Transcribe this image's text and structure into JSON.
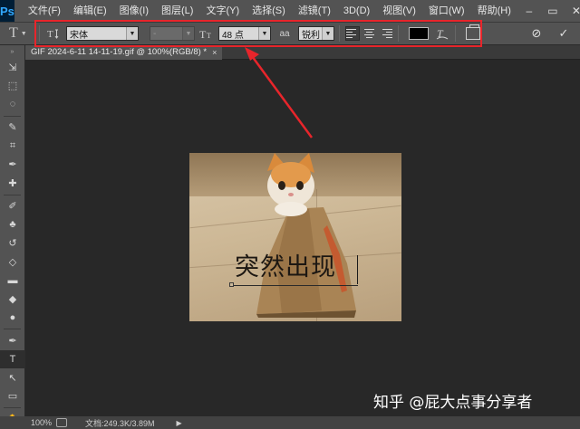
{
  "app": {
    "logo": "Ps"
  },
  "menu": [
    "文件(F)",
    "编辑(E)",
    "图像(I)",
    "图层(L)",
    "文字(Y)",
    "选择(S)",
    "滤镜(T)",
    "3D(D)",
    "视图(V)",
    "窗口(W)",
    "帮助(H)"
  ],
  "window_controls": [
    "–",
    "▭",
    "✕"
  ],
  "options": {
    "tool_preset_icon": "T",
    "orientation_icon": "text-orientation-icon",
    "font_family": "宋体",
    "font_style": "-",
    "size_icon": "font-size-icon",
    "font_size": "48 点",
    "aa_icon_text": "aa",
    "anti_alias": "锐利",
    "alignment": [
      "left",
      "center",
      "right"
    ],
    "active_alignment": "left",
    "text_color": "#000000",
    "warp_icon": "warp-text-icon",
    "panels_icon": "character-panel-icon",
    "cancel_symbol": "⊘",
    "commit_symbol": "✓"
  },
  "document": {
    "tab_title": "GIF 2024-6-11 14-11-19.gif @ 100%(RGB/8) *",
    "tab_close": "×",
    "layer_text": "突然出现"
  },
  "tools": [
    "move-tool-icon",
    "marquee-tool-icon",
    "lasso-tool-icon",
    "quick-selection-tool-icon",
    "crop-tool-icon",
    "eyedropper-tool-icon",
    "healing-brush-tool-icon",
    "brush-tool-icon",
    "clone-stamp-tool-icon",
    "history-brush-tool-icon",
    "eraser-tool-icon",
    "gradient-tool-icon",
    "blur-tool-icon",
    "dodge-tool-icon",
    "pen-tool-icon",
    "type-tool-icon",
    "path-selection-tool-icon",
    "rectangle-tool-icon",
    "hand-tool-icon",
    "zoom-tool-icon"
  ],
  "tool_glyphs": [
    "⇲",
    "⬚",
    "◌",
    "✎",
    "⌗",
    "✒",
    "✚",
    "✐",
    "♣",
    "↺",
    "◇",
    "▬",
    "◆",
    "●",
    "✒",
    "T",
    "↖",
    "▭",
    "✋",
    "⚲"
  ],
  "active_tool": "type-tool-icon",
  "status": {
    "zoom": "100%",
    "doc_size": "文档:249.3K/3.89M",
    "arrow": "▶"
  },
  "watermark": "知乎 @屁大点事分享者",
  "colors": {
    "highlight": "#e8252b",
    "accent": "#31a8ff"
  }
}
